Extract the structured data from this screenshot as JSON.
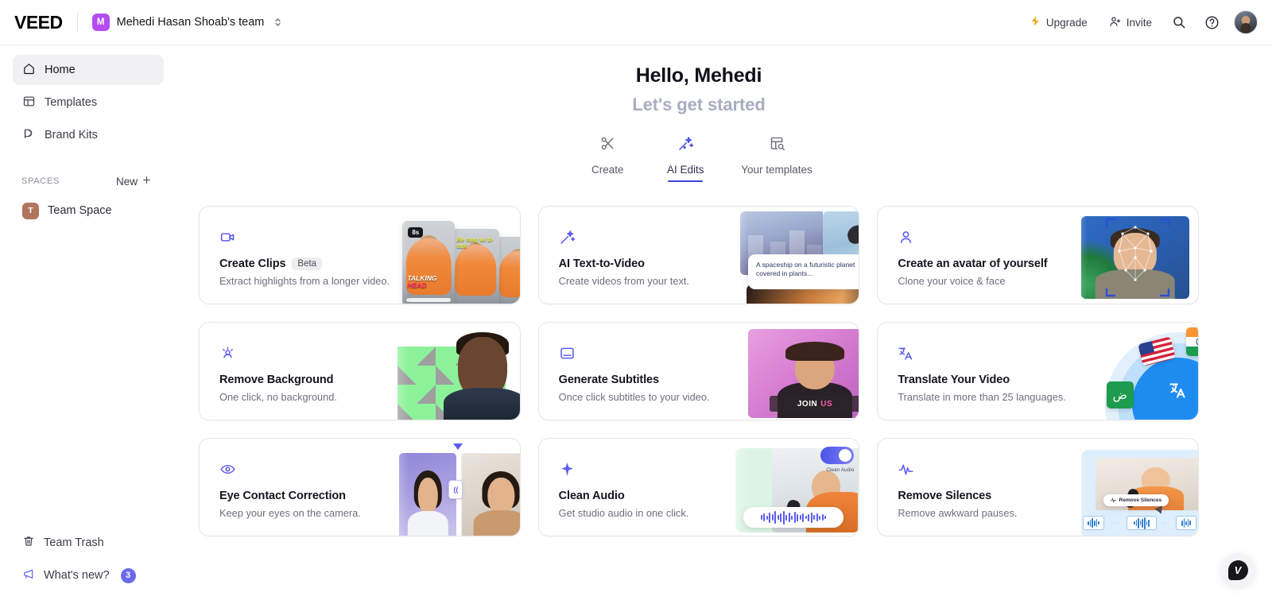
{
  "header": {
    "logo": "VEED",
    "team": {
      "initial": "M",
      "name": "Mehedi Hasan Shoab's team"
    },
    "upgrade_label": "Upgrade",
    "invite_label": "Invite",
    "search_icon": "search-icon",
    "help_icon": "help-circle-icon",
    "avatar_name": "user-avatar"
  },
  "sidebar": {
    "nav": [
      {
        "label": "Home",
        "icon": "home-icon",
        "active": true
      },
      {
        "label": "Templates",
        "icon": "templates-icon",
        "active": false
      },
      {
        "label": "Brand Kits",
        "icon": "brand-kits-icon",
        "active": false
      }
    ],
    "spaces_label": "SPACES",
    "new_label": "New",
    "spaces": [
      {
        "initial": "T",
        "label": "Team Space"
      }
    ],
    "bottom": [
      {
        "label": "Team Trash",
        "icon": "trash-icon",
        "badge": ""
      },
      {
        "label": "What's new?",
        "icon": "megaphone-icon",
        "badge": "3"
      }
    ]
  },
  "main": {
    "greeting_title": "Hello, Mehedi",
    "greeting_subtitle": "Let's get started",
    "tabs": [
      {
        "label": "Create",
        "icon": "scissors-icon",
        "active": false
      },
      {
        "label": "AI Edits",
        "icon": "magic-wand-icon",
        "active": true
      },
      {
        "label": "Your templates",
        "icon": "template-search-icon",
        "active": false
      }
    ],
    "cards": [
      {
        "title": "Create Clips",
        "badge": "Beta",
        "subtitle": "Extract highlights from a longer video.",
        "icon": "video-camera-icon",
        "thumb": "clips",
        "thumb_texts": {
          "duration": "8s",
          "caption_line1": "TALKING",
          "caption_line2": "HEAD",
          "caption2": "Be mag w/ d-talk"
        }
      },
      {
        "title": "AI Text-to-Video",
        "badge": "",
        "subtitle": "Create videos from your text.",
        "icon": "magic-wand-icon",
        "thumb": "text-to-video",
        "thumb_texts": {
          "prompt": "A spaceship on a futuristic planet covered in plants..."
        }
      },
      {
        "title": "Create an avatar of yourself",
        "badge": "",
        "subtitle": "Clone your voice & face",
        "icon": "person-icon",
        "thumb": "avatar",
        "thumb_texts": {}
      },
      {
        "title": "Remove Background",
        "badge": "",
        "subtitle": "One click, no background.",
        "icon": "person-cutout-icon",
        "thumb": "remove-background",
        "thumb_texts": {}
      },
      {
        "title": "Generate Subtitles",
        "badge": "",
        "subtitle": "Once click subtitles to your video.",
        "icon": "subtitles-icon",
        "thumb": "subtitles",
        "thumb_texts": {
          "caption_a": "JOIN",
          "caption_b": "US"
        }
      },
      {
        "title": "Translate Your Video",
        "badge": "",
        "subtitle": "Translate in more than 25 languages.",
        "icon": "translate-icon",
        "thumb": "translate",
        "thumb_texts": {
          "arabic_glyph": "ض"
        }
      },
      {
        "title": "Eye Contact Correction",
        "badge": "",
        "subtitle": "Keep your eyes on the camera.",
        "icon": "eye-icon",
        "thumb": "eye-contact",
        "thumb_texts": {
          "handle": "(("
        }
      },
      {
        "title": "Clean Audio",
        "badge": "",
        "subtitle": "Get studio audio in one click.",
        "icon": "sparkle-icon",
        "thumb": "clean-audio",
        "thumb_texts": {
          "toggle_label": "Clean Audio"
        }
      },
      {
        "title": "Remove Silences",
        "badge": "",
        "subtitle": "Remove awkward pauses.",
        "icon": "waveform-icon",
        "thumb": "remove-silences",
        "thumb_texts": {
          "pill": "Remove Silences"
        }
      }
    ]
  },
  "chat": {
    "icon": "veed-chat-icon",
    "mark": "V"
  },
  "colors": {
    "accent": "#5b5bf5",
    "tab_active": "#3b46d8",
    "badge": "#6b6bea",
    "team_avatar": "#b44cf0",
    "space_avatar": "#b0755c",
    "upgrade_bolt": "#f5a623"
  }
}
